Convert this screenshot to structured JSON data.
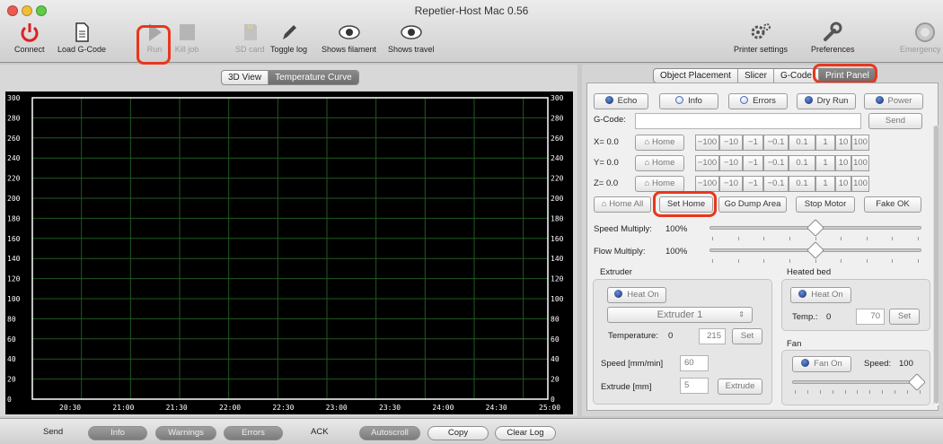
{
  "window": {
    "title": "Repetier-Host Mac 0.56",
    "traffic_lights": [
      "#ee5a52",
      "#f1be3a",
      "#5fcb47"
    ]
  },
  "toolbar": {
    "connect": "Connect",
    "load_gcode": "Load G-Code",
    "run": "Run",
    "kill_job": "Kill job",
    "sd_card": "SD card",
    "toggle_log": "Toggle log",
    "shows_filament": "Shows filament",
    "shows_travel": "Shows travel",
    "printer_settings": "Printer settings",
    "preferences": "Preferences",
    "emergency_stop": "Emergency St"
  },
  "left_tabs": [
    "3D View",
    "Temperature Curve"
  ],
  "left_tabs_selected": "Temperature Curve",
  "chart_data": {
    "type": "line",
    "title": "",
    "xlabel": "",
    "ylabel": "",
    "x_ticks": [
      "20:30",
      "21:00",
      "21:30",
      "22:00",
      "22:30",
      "23:00",
      "23:30",
      "24:00",
      "24:30",
      "25:00"
    ],
    "y_ticks": [
      "300",
      "280",
      "260",
      "240",
      "220",
      "200",
      "180",
      "160",
      "140",
      "120",
      "100",
      "80",
      "60",
      "40",
      "20",
      "0"
    ],
    "ylim": [
      0,
      300
    ],
    "series": [],
    "grid": true,
    "background": "#000000",
    "grid_color": "#1f5a1f"
  },
  "right_tabs": [
    "Object Placement",
    "Slicer",
    "G-Code",
    "Print Panel"
  ],
  "right_tabs_selected": "Print Panel",
  "print_panel": {
    "toggles": {
      "echo": "Echo",
      "info": "Info",
      "errors": "Errors",
      "dry_run": "Dry Run",
      "power": "Power"
    },
    "gcode_label": "G-Code:",
    "gcode_value": "",
    "send": "Send",
    "axes": [
      {
        "label": "X= 0.0",
        "home": "Home"
      },
      {
        "label": "Y= 0.0",
        "home": "Home"
      },
      {
        "label": "Z= 0.0",
        "home": "Home"
      }
    ],
    "jog_steps": [
      "−100",
      "−10",
      "−1",
      "−0.1",
      "0.1",
      "1",
      "10",
      "100"
    ],
    "actions": {
      "home_all": "Home All",
      "set_home": "Set Home",
      "go_dump_area": "Go Dump Area",
      "stop_motor": "Stop Motor",
      "fake_ok": "Fake OK"
    },
    "speed_multiply": {
      "label": "Speed Multiply:",
      "value": "100%",
      "level": 0.5
    },
    "flow_multiply": {
      "label": "Flow Multiply:",
      "value": "100%",
      "level": 0.5
    },
    "extruder": {
      "title": "Extruder",
      "heat_on": "Heat On",
      "selected": "Extruder 1",
      "temperature_label": "Temperature:",
      "temperature": "0",
      "target": "215",
      "set": "Set",
      "speed_label": "Speed [mm/min]",
      "speed": "60",
      "extrude_label": "Extrude [mm]",
      "extrude": "5",
      "extrude_button": "Extrude"
    },
    "heated_bed": {
      "title": "Heated bed",
      "heat_on": "Heat On",
      "temp_label": "Temp.:",
      "temp": "0",
      "target": "70",
      "set": "Set"
    },
    "fan": {
      "title": "Fan",
      "fan_on": "Fan On",
      "speed_label": "Speed:",
      "speed": "100",
      "level": 1.0
    }
  },
  "log_bar": {
    "send": "Send",
    "info": "Info",
    "warnings": "Warnings",
    "errors": "Errors",
    "ack": "ACK",
    "autoscroll": "Autoscroll",
    "copy": "Copy",
    "clear_log": "Clear Log"
  },
  "highlight_color": "#e8371c"
}
